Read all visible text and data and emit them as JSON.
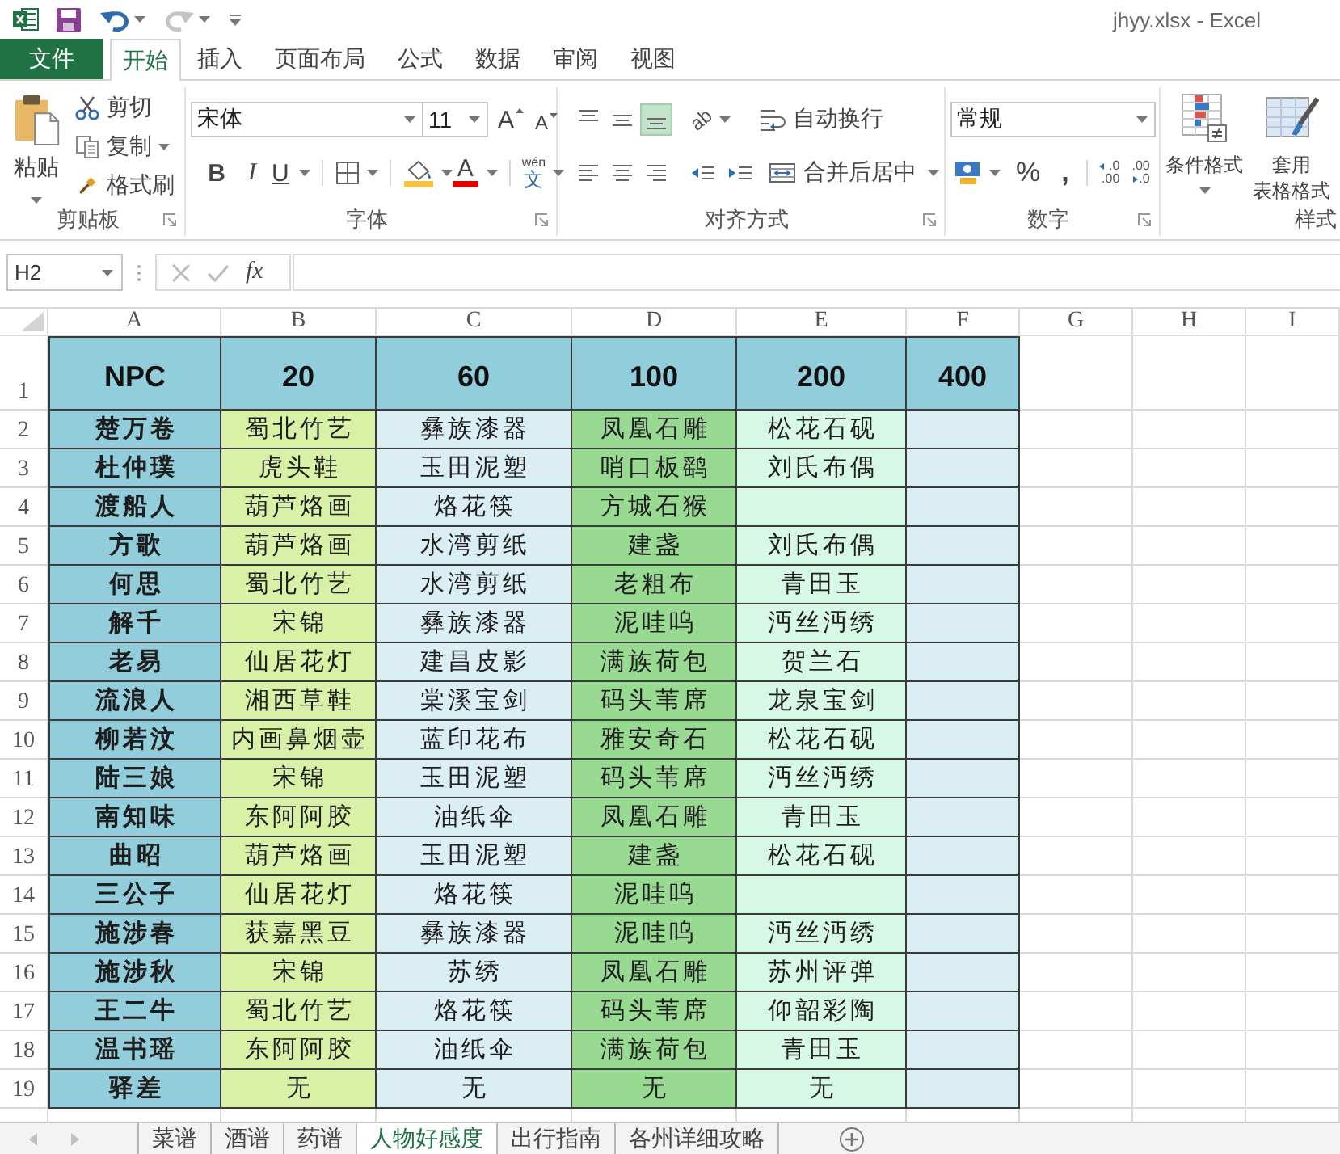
{
  "title_bar": {
    "title": "jhyy.xlsx - Excel"
  },
  "ribbon_tabs": [
    {
      "label": "文件",
      "kind": "file",
      "selected": false
    },
    {
      "label": "开始",
      "kind": "tab",
      "selected": true
    },
    {
      "label": "插入",
      "kind": "tab",
      "selected": false
    },
    {
      "label": "页面布局",
      "kind": "tab",
      "selected": false
    },
    {
      "label": "公式",
      "kind": "tab",
      "selected": false
    },
    {
      "label": "数据",
      "kind": "tab",
      "selected": false
    },
    {
      "label": "审阅",
      "kind": "tab",
      "selected": false
    },
    {
      "label": "视图",
      "kind": "tab",
      "selected": false
    }
  ],
  "clipboard": {
    "paste": "粘贴",
    "cut": "剪切",
    "copy": "复制",
    "format_painter": "格式刷",
    "label": "剪贴板"
  },
  "font": {
    "name": "宋体",
    "size": "11",
    "grow": "A",
    "shrink": "A",
    "bold": "B",
    "italic": "I",
    "underline": "U",
    "font_color": "A",
    "phonetic_ruby": "wén",
    "phonetic_base": "文",
    "label": "字体"
  },
  "alignment": {
    "align_buttons": [
      {
        "kind": "top",
        "selected": false
      },
      {
        "kind": "middle",
        "selected": false
      },
      {
        "kind": "bottom",
        "selected": true
      },
      {
        "kind": "left",
        "selected": false
      },
      {
        "kind": "center",
        "selected": false
      },
      {
        "kind": "right",
        "selected": false
      }
    ],
    "orientation": "ab",
    "wrap_text": "自动换行",
    "merge_center": "合并后居中",
    "label": "对齐方式"
  },
  "number": {
    "format": "常规",
    "percent": "%",
    "comma": ",",
    "increase_decimal": [
      ".0",
      ".00"
    ],
    "decrease_decimal": [
      ".00",
      ".0"
    ],
    "label": "数字"
  },
  "styles": {
    "conditional_format": "条件格式",
    "format_as_table": [
      "套用",
      "表格格式"
    ],
    "label": "样式"
  },
  "formula_bar": {
    "name_box": "H2",
    "function_label": "fx"
  },
  "sheet": {
    "columns": [
      {
        "header": "A",
        "color": "#92cddc"
      },
      {
        "header": "B",
        "color": "#d8f1a6"
      },
      {
        "header": "C",
        "color": "#daeef3"
      },
      {
        "header": "D",
        "color": "#98da92"
      },
      {
        "header": "E",
        "color": "#d6f8e4"
      },
      {
        "header": "F",
        "color": "#daeef3"
      },
      {
        "header": "G"
      },
      {
        "header": "H"
      },
      {
        "header": "I"
      }
    ],
    "rows": [
      {
        "number": "1",
        "kind": "header",
        "cells": [
          "NPC",
          "20",
          "60",
          "100",
          "200",
          "400"
        ]
      },
      {
        "number": "2",
        "kind": "body",
        "cells": [
          "楚万卷",
          "蜀北竹艺",
          "彝族漆器",
          "凤凰石雕",
          "松花石砚",
          null
        ]
      },
      {
        "number": "3",
        "kind": "body",
        "cells": [
          "杜仲璞",
          "虎头鞋",
          "玉田泥塑",
          "哨口板鹞",
          "刘氏布偶",
          null
        ]
      },
      {
        "number": "4",
        "kind": "body",
        "cells": [
          "渡船人",
          "葫芦烙画",
          "烙花筷",
          "方城石猴",
          null,
          null
        ]
      },
      {
        "number": "5",
        "kind": "body",
        "cells": [
          "方歌",
          "葫芦烙画",
          "水湾剪纸",
          "建盏",
          "刘氏布偶",
          null
        ]
      },
      {
        "number": "6",
        "kind": "body",
        "cells": [
          "何思",
          "蜀北竹艺",
          "水湾剪纸",
          "老粗布",
          "青田玉",
          null
        ]
      },
      {
        "number": "7",
        "kind": "body",
        "cells": [
          "解千",
          "宋锦",
          "彝族漆器",
          "泥哇呜",
          "沔丝沔绣",
          null
        ]
      },
      {
        "number": "8",
        "kind": "body",
        "cells": [
          "老易",
          "仙居花灯",
          "建昌皮影",
          "满族荷包",
          "贺兰石",
          null
        ]
      },
      {
        "number": "9",
        "kind": "body",
        "cells": [
          "流浪人",
          "湘西草鞋",
          "棠溪宝剑",
          "码头苇席",
          "龙泉宝剑",
          null
        ]
      },
      {
        "number": "10",
        "kind": "body",
        "cells": [
          "柳若汶",
          "内画鼻烟壶",
          "蓝印花布",
          "雅安奇石",
          "松花石砚",
          null
        ]
      },
      {
        "number": "11",
        "kind": "body",
        "cells": [
          "陆三娘",
          "宋锦",
          "玉田泥塑",
          "码头苇席",
          "沔丝沔绣",
          null
        ]
      },
      {
        "number": "12",
        "kind": "body",
        "cells": [
          "南知味",
          "东阿阿胶",
          "油纸伞",
          "凤凰石雕",
          "青田玉",
          null
        ]
      },
      {
        "number": "13",
        "kind": "body",
        "cells": [
          "曲昭",
          "葫芦烙画",
          "玉田泥塑",
          "建盏",
          "松花石砚",
          null
        ]
      },
      {
        "number": "14",
        "kind": "body",
        "cells": [
          "三公子",
          "仙居花灯",
          "烙花筷",
          "泥哇呜",
          null,
          null
        ]
      },
      {
        "number": "15",
        "kind": "body",
        "cells": [
          "施涉春",
          "获嘉黑豆",
          "彝族漆器",
          "泥哇呜",
          "沔丝沔绣",
          null
        ]
      },
      {
        "number": "16",
        "kind": "body",
        "cells": [
          "施涉秋",
          "宋锦",
          "苏绣",
          "凤凰石雕",
          "苏州评弹",
          null
        ]
      },
      {
        "number": "17",
        "kind": "body",
        "cells": [
          "王二牛",
          "蜀北竹艺",
          "烙花筷",
          "码头苇席",
          "仰韶彩陶",
          null
        ]
      },
      {
        "number": "18",
        "kind": "body",
        "cells": [
          "温书瑶",
          "东阿阿胶",
          "油纸伞",
          "满族荷包",
          "青田玉",
          null
        ]
      },
      {
        "number": "19",
        "kind": "body",
        "cells": [
          "驿差",
          "无",
          "无",
          "无",
          "无",
          null
        ]
      }
    ]
  },
  "sheet_tabs": [
    {
      "label": "菜谱",
      "selected": false
    },
    {
      "label": "酒谱",
      "selected": false
    },
    {
      "label": "药谱",
      "selected": false
    },
    {
      "label": "人物好感度",
      "selected": true
    },
    {
      "label": "出行指南",
      "selected": false
    },
    {
      "label": "各州详细攻略",
      "selected": false
    }
  ]
}
